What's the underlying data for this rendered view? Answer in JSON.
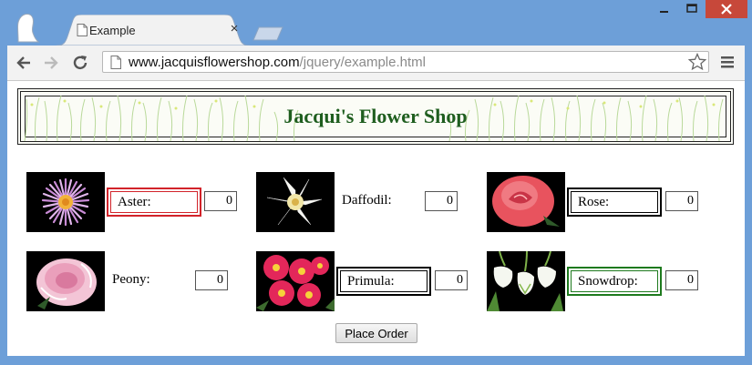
{
  "browser": {
    "tab_title": "Example",
    "tab_close_glyph": "×",
    "url_host": "www.jacquisflowershop.com",
    "url_path": "/jquery/example.html",
    "icons": [
      "profile-icon",
      "page-icon",
      "close-icon",
      "new-tab-icon",
      "minimize-icon",
      "maximize-icon",
      "window-close-icon",
      "back-icon",
      "forward-icon",
      "reload-icon",
      "bookmark-star-icon",
      "menu-icon"
    ]
  },
  "page": {
    "title": "Jacqui's Flower Shop",
    "order_button": "Place Order",
    "flowers": [
      {
        "label": "Aster:",
        "quantity": "0",
        "highlight": "red",
        "image": "aster-image"
      },
      {
        "label": "Daffodil:",
        "quantity": "0",
        "highlight": "none",
        "image": "daffodil-image"
      },
      {
        "label": "Rose:",
        "quantity": "0",
        "highlight": "black",
        "image": "rose-image"
      },
      {
        "label": "Peony:",
        "quantity": "0",
        "highlight": "none",
        "image": "peony-image"
      },
      {
        "label": "Primula:",
        "quantity": "0",
        "highlight": "black",
        "image": "primula-image"
      },
      {
        "label": "Snowdrop:",
        "quantity": "0",
        "highlight": "green",
        "image": "snowdrop-image"
      }
    ]
  },
  "colors": {
    "window_frame": "#6d9fd8",
    "title_color": "#1f5e1f",
    "highlight_red": "#d2232a",
    "highlight_black": "#000000",
    "highlight_green": "#1e7a1e",
    "close_button": "#c7483a"
  }
}
